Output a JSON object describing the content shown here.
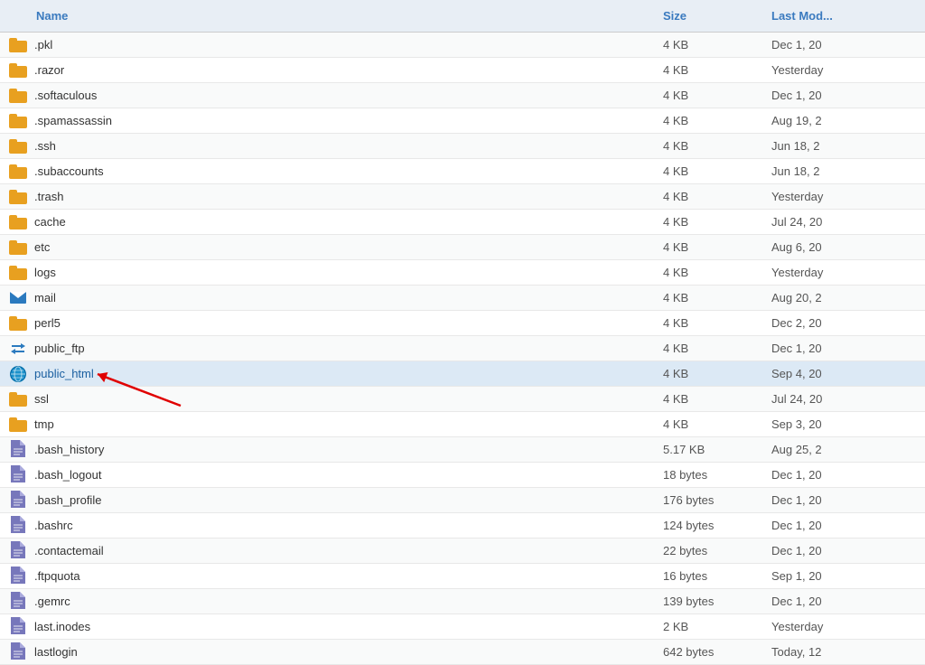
{
  "columns": {
    "name": "Name",
    "size": "Size",
    "lastModified": "Last Mod..."
  },
  "files": [
    {
      "id": "pkl",
      "name": ".pkl",
      "type": "folder",
      "size": "4 KB",
      "date": "Dec 1, 20",
      "highlighted": false
    },
    {
      "id": "razor",
      "name": ".razor",
      "type": "folder",
      "size": "4 KB",
      "date": "Yesterday",
      "highlighted": false
    },
    {
      "id": "softaculous",
      "name": ".softaculous",
      "type": "folder",
      "size": "4 KB",
      "date": "Dec 1, 20",
      "highlighted": false
    },
    {
      "id": "spamassassin",
      "name": ".spamassassin",
      "type": "folder",
      "size": "4 KB",
      "date": "Aug 19, 2",
      "highlighted": false
    },
    {
      "id": "ssh",
      "name": ".ssh",
      "type": "folder",
      "size": "4 KB",
      "date": "Jun 18, 2",
      "highlighted": false
    },
    {
      "id": "subaccounts",
      "name": ".subaccounts",
      "type": "folder",
      "size": "4 KB",
      "date": "Jun 18, 2",
      "highlighted": false
    },
    {
      "id": "trash",
      "name": ".trash",
      "type": "folder",
      "size": "4 KB",
      "date": "Yesterday",
      "highlighted": false
    },
    {
      "id": "cache",
      "name": "cache",
      "type": "folder",
      "size": "4 KB",
      "date": "Jul 24, 20",
      "highlighted": false
    },
    {
      "id": "etc",
      "name": "etc",
      "type": "folder",
      "size": "4 KB",
      "date": "Aug 6, 20",
      "highlighted": false
    },
    {
      "id": "logs",
      "name": "logs",
      "type": "folder",
      "size": "4 KB",
      "date": "Yesterday",
      "highlighted": false
    },
    {
      "id": "mail",
      "name": "mail",
      "type": "mail",
      "size": "4 KB",
      "date": "Aug 20, 2",
      "highlighted": false
    },
    {
      "id": "perl5",
      "name": "perl5",
      "type": "folder",
      "size": "4 KB",
      "date": "Dec 2, 20",
      "highlighted": false
    },
    {
      "id": "public_ftp",
      "name": "public_ftp",
      "type": "ftp",
      "size": "4 KB",
      "date": "Dec 1, 20",
      "highlighted": false
    },
    {
      "id": "public_html",
      "name": "public_html",
      "type": "globe",
      "size": "4 KB",
      "date": "Sep 4, 20",
      "highlighted": true
    },
    {
      "id": "ssl",
      "name": "ssl",
      "type": "folder",
      "size": "4 KB",
      "date": "Jul 24, 20",
      "highlighted": false
    },
    {
      "id": "tmp",
      "name": "tmp",
      "type": "folder",
      "size": "4 KB",
      "date": "Sep 3, 20",
      "highlighted": false
    },
    {
      "id": "bash_history",
      "name": ".bash_history",
      "type": "doc",
      "size": "5.17 KB",
      "date": "Aug 25, 2",
      "highlighted": false
    },
    {
      "id": "bash_logout",
      "name": ".bash_logout",
      "type": "doc",
      "size": "18 bytes",
      "date": "Dec 1, 20",
      "highlighted": false
    },
    {
      "id": "bash_profile",
      "name": ".bash_profile",
      "type": "doc",
      "size": "176 bytes",
      "date": "Dec 1, 20",
      "highlighted": false
    },
    {
      "id": "bashrc",
      "name": ".bashrc",
      "type": "doc",
      "size": "124 bytes",
      "date": "Dec 1, 20",
      "highlighted": false
    },
    {
      "id": "contactemail",
      "name": ".contactemail",
      "type": "doc",
      "size": "22 bytes",
      "date": "Dec 1, 20",
      "highlighted": false
    },
    {
      "id": "ftpquota",
      "name": ".ftpquota",
      "type": "doc",
      "size": "16 bytes",
      "date": "Sep 1, 20",
      "highlighted": false
    },
    {
      "id": "gemrc",
      "name": ".gemrc",
      "type": "doc",
      "size": "139 bytes",
      "date": "Dec 1, 20",
      "highlighted": false
    },
    {
      "id": "last_inodes",
      "name": "last.inodes",
      "type": "doc",
      "size": "2 KB",
      "date": "Yesterday",
      "highlighted": false
    },
    {
      "id": "lastlogin",
      "name": "lastlogin",
      "type": "doc",
      "size": "642 bytes",
      "date": "Today, 12",
      "highlighted": false
    }
  ],
  "annotation": {
    "arrowColor": "#e00000",
    "targetRow": "public_html"
  }
}
